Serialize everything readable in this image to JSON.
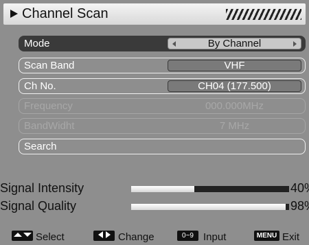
{
  "title": "Channel Scan",
  "menu": {
    "mode": {
      "label": "Mode",
      "value": "By Channel"
    },
    "scan_band": {
      "label": "Scan Band",
      "value": "VHF"
    },
    "ch_no": {
      "label": "Ch No.",
      "value": "CH04 (177.500)"
    },
    "frequency": {
      "label": "Frequency",
      "value": "000.000MHz"
    },
    "bandwidth": {
      "label": "BandWidht",
      "value": "7 MHz"
    },
    "search": {
      "label": "Search"
    }
  },
  "signal": {
    "intensity": {
      "label": "Signal Intensity",
      "percent": 40,
      "text": "40%"
    },
    "quality": {
      "label": "Signal Quality",
      "percent": 98,
      "text": "98%"
    }
  },
  "footer": {
    "select": "Select",
    "change": "Change",
    "input_key": "0~9",
    "input": "Input",
    "menu_key": "MENU",
    "exit": "Exit"
  }
}
